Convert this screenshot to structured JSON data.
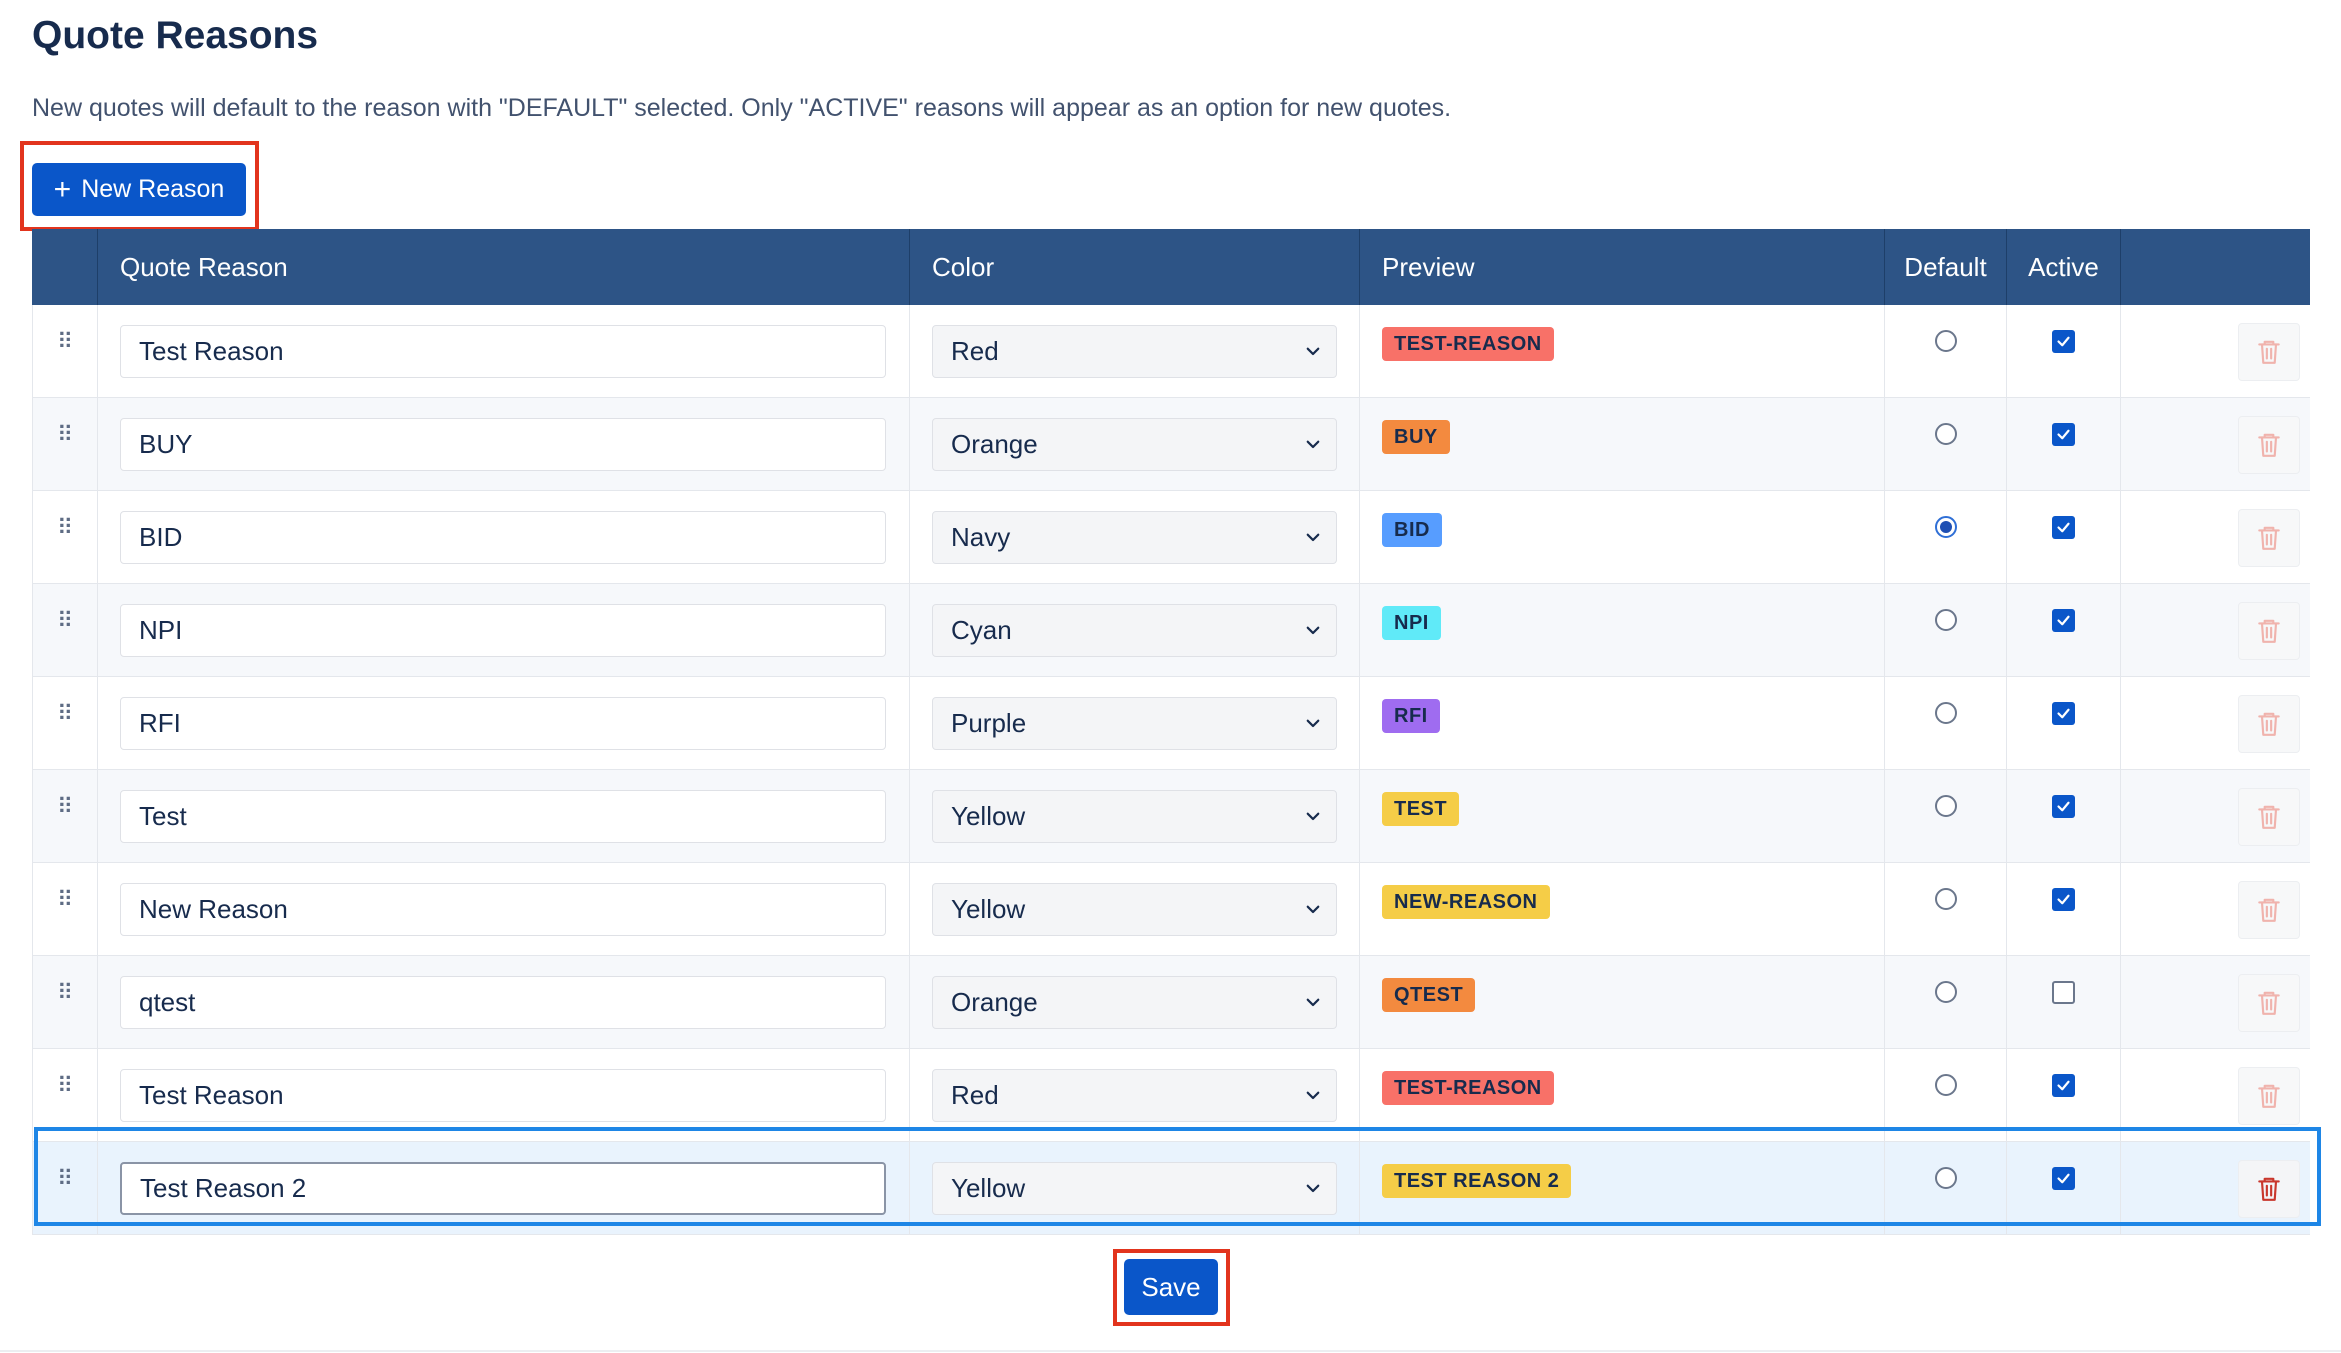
{
  "page": {
    "title": "Quote Reasons",
    "description": "New quotes will default to the reason with \"DEFAULT\" selected. Only \"ACTIVE\" reasons will appear as an option for new quotes."
  },
  "new_button": {
    "icon": "plus-icon",
    "label": "New Reason"
  },
  "table": {
    "headers": {
      "reason": "Quote Reason",
      "color": "Color",
      "preview": "Preview",
      "default": "Default",
      "active": "Active"
    },
    "rows": [
      {
        "name": "Test Reason",
        "color": "Red",
        "preview": "TEST-REASON",
        "badge_bg": "#f87168",
        "default": false,
        "active": true
      },
      {
        "name": "BUY",
        "color": "Orange",
        "preview": "BUY",
        "badge_bg": "#f38a3f",
        "default": false,
        "active": true
      },
      {
        "name": "BID",
        "color": "Navy",
        "preview": "BID",
        "badge_bg": "#579dff",
        "default": true,
        "active": true
      },
      {
        "name": "NPI",
        "color": "Cyan",
        "preview": "NPI",
        "badge_bg": "#60eaf8",
        "default": false,
        "active": true
      },
      {
        "name": "RFI",
        "color": "Purple",
        "preview": "RFI",
        "badge_bg": "#9f6cf0",
        "default": false,
        "active": true
      },
      {
        "name": "Test",
        "color": "Yellow",
        "preview": "TEST",
        "badge_bg": "#f5cd47",
        "default": false,
        "active": true
      },
      {
        "name": "New Reason",
        "color": "Yellow",
        "preview": "NEW-REASON",
        "badge_bg": "#f5cd47",
        "default": false,
        "active": true
      },
      {
        "name": "qtest",
        "color": "Orange",
        "preview": "QTEST",
        "badge_bg": "#f38a3f",
        "default": false,
        "active": false
      },
      {
        "name": "Test Reason",
        "color": "Red",
        "preview": "TEST-REASON",
        "badge_bg": "#f87168",
        "default": false,
        "active": true
      },
      {
        "name": "Test Reason 2",
        "color": "Yellow",
        "preview": "TEST REASON 2",
        "badge_bg": "#f5cd47",
        "default": false,
        "active": true,
        "selected": true
      }
    ]
  },
  "save_button": {
    "label": "Save"
  },
  "colors": {
    "header_bg": "#2d5486",
    "primary": "#0a56c9",
    "highlight_outline": "#e2341d",
    "selection_outline": "#1e86e6"
  }
}
